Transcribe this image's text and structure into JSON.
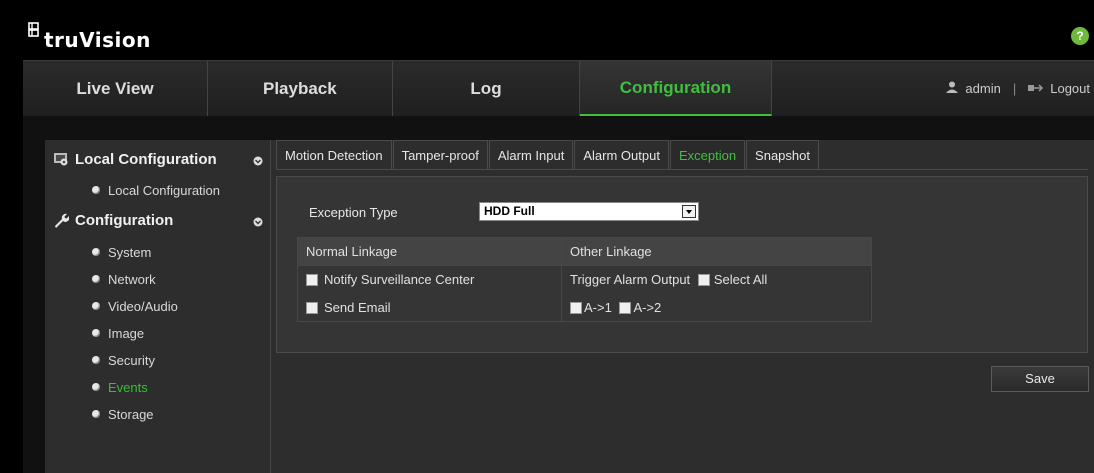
{
  "brand": {
    "name": "truVision"
  },
  "help": {
    "label": "?"
  },
  "nav": {
    "tabs": [
      {
        "label": "Live View"
      },
      {
        "label": "Playback"
      },
      {
        "label": "Log"
      },
      {
        "label": "Configuration",
        "active": true
      }
    ],
    "user": "admin",
    "separator": "|",
    "logout": "Logout"
  },
  "sidebar": {
    "local_config": {
      "title": "Local Configuration",
      "items": [
        "Local Configuration"
      ]
    },
    "configuration": {
      "title": "Configuration",
      "items": [
        "System",
        "Network",
        "Video/Audio",
        "Image",
        "Security",
        "Events",
        "Storage"
      ],
      "active_item": "Events"
    }
  },
  "subtabs": {
    "items": [
      "Motion Detection",
      "Tamper-proof",
      "Alarm Input",
      "Alarm Output",
      "Exception",
      "Snapshot"
    ],
    "active": "Exception"
  },
  "form": {
    "exception_type_label": "Exception Type",
    "exception_type_value": "HDD Full",
    "normal_linkage": "Normal Linkage",
    "other_linkage": "Other Linkage",
    "notify_center": "Notify Surveillance Center",
    "send_email": "Send Email",
    "trigger_alarm_output": "Trigger Alarm Output",
    "select_all": "Select All",
    "output_1": "A->1",
    "output_2": "A->2"
  },
  "save_label": "Save",
  "colors": {
    "accent": "#3ec03e",
    "help": "#6dba3d",
    "background": "#000000",
    "panel": "#2d2d2d"
  }
}
